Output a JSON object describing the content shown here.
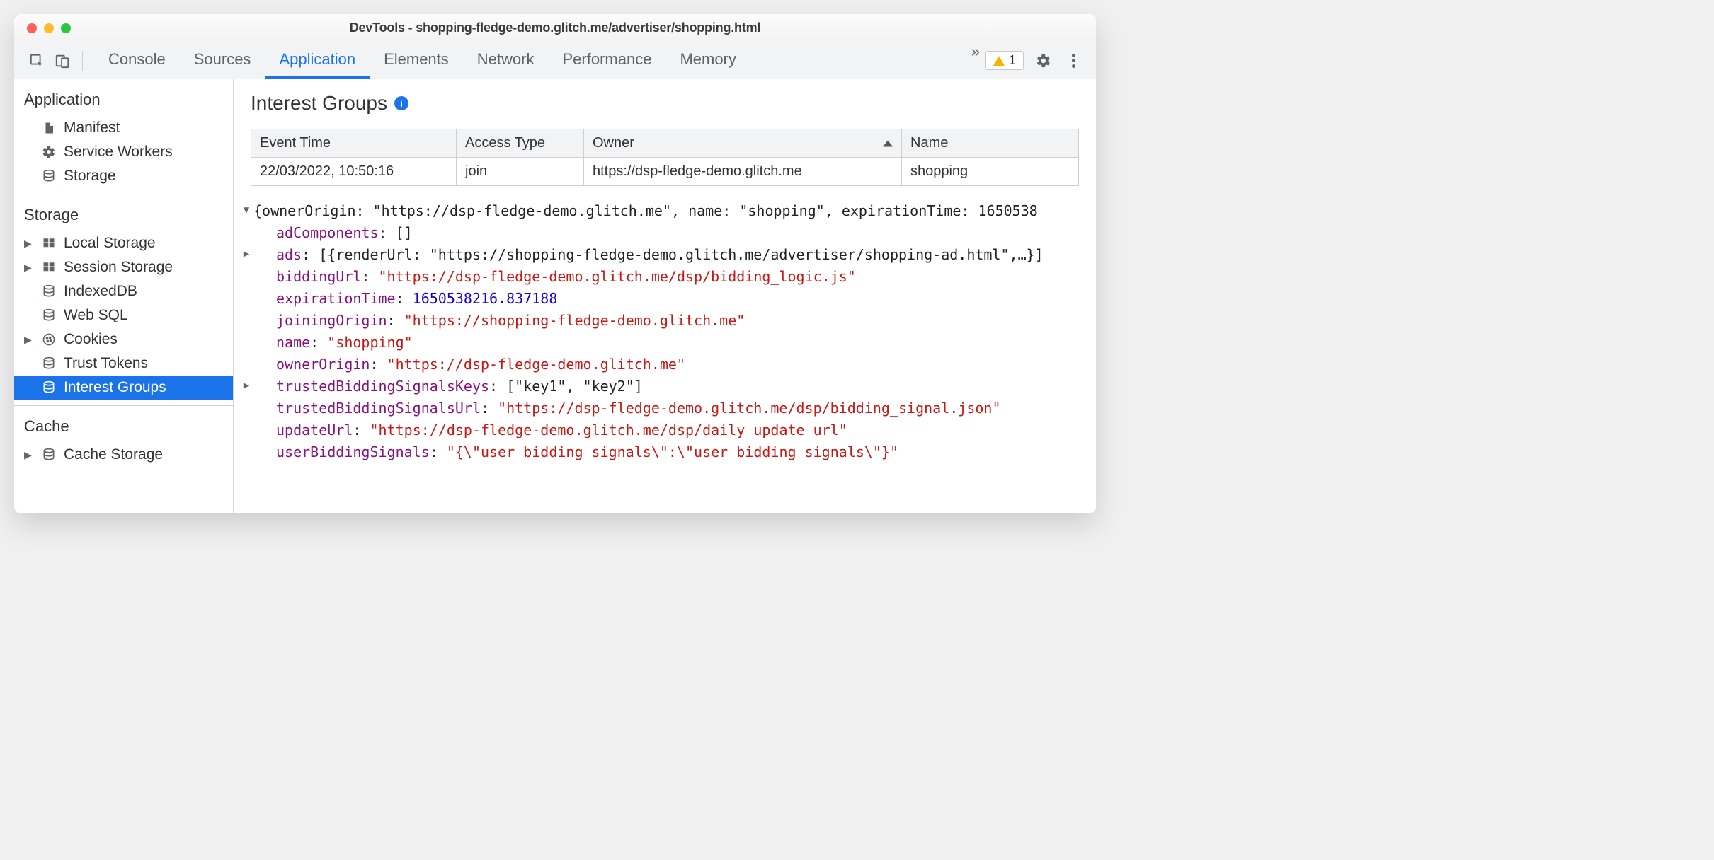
{
  "window": {
    "title": "DevTools - shopping-fledge-demo.glitch.me/advertiser/shopping.html"
  },
  "toolbar": {
    "tabs": [
      "Console",
      "Sources",
      "Application",
      "Elements",
      "Network",
      "Performance",
      "Memory"
    ],
    "active_tab_index": 2,
    "warnings_count": "1"
  },
  "sidebar": {
    "groups": [
      {
        "title": "Application",
        "items": [
          {
            "label": "Manifest",
            "icon": "file",
            "expandable": false
          },
          {
            "label": "Service Workers",
            "icon": "gear",
            "expandable": false
          },
          {
            "label": "Storage",
            "icon": "db",
            "expandable": false
          }
        ]
      },
      {
        "title": "Storage",
        "items": [
          {
            "label": "Local Storage",
            "icon": "grid",
            "expandable": true
          },
          {
            "label": "Session Storage",
            "icon": "grid",
            "expandable": true
          },
          {
            "label": "IndexedDB",
            "icon": "db",
            "expandable": false
          },
          {
            "label": "Web SQL",
            "icon": "db",
            "expandable": false
          },
          {
            "label": "Cookies",
            "icon": "cookie",
            "expandable": true
          },
          {
            "label": "Trust Tokens",
            "icon": "db",
            "expandable": false
          },
          {
            "label": "Interest Groups",
            "icon": "db",
            "expandable": false,
            "selected": true
          }
        ]
      },
      {
        "title": "Cache",
        "items": [
          {
            "label": "Cache Storage",
            "icon": "db",
            "expandable": true
          }
        ]
      }
    ]
  },
  "panel": {
    "title": "Interest Groups",
    "table": {
      "headers": [
        "Event Time",
        "Access Type",
        "Owner",
        "Name"
      ],
      "sort_column_index": 2,
      "rows": [
        [
          "22/03/2022, 10:50:16",
          "join",
          "https://dsp-fledge-demo.glitch.me",
          "shopping"
        ]
      ]
    },
    "object": {
      "summary_line": "{ownerOrigin: \"https://dsp-fledge-demo.glitch.me\", name: \"shopping\", expirationTime: 1650538",
      "props": {
        "adComponents": {
          "type": "plain",
          "value": "[]"
        },
        "ads": {
          "type": "plain",
          "value": "[{renderUrl: \"https://shopping-fledge-demo.glitch.me/advertiser/shopping-ad.html\",…}]",
          "expandable": true
        },
        "biddingUrl": {
          "type": "string",
          "value": "\"https://dsp-fledge-demo.glitch.me/dsp/bidding_logic.js\""
        },
        "expirationTime": {
          "type": "number",
          "value": "1650538216.837188"
        },
        "joiningOrigin": {
          "type": "string",
          "value": "\"https://shopping-fledge-demo.glitch.me\""
        },
        "name": {
          "type": "string",
          "value": "\"shopping\""
        },
        "ownerOrigin": {
          "type": "string",
          "value": "\"https://dsp-fledge-demo.glitch.me\""
        },
        "trustedBiddingSignalsKeys": {
          "type": "plain",
          "value": "[\"key1\", \"key2\"]",
          "expandable": true
        },
        "trustedBiddingSignalsUrl": {
          "type": "string",
          "value": "\"https://dsp-fledge-demo.glitch.me/dsp/bidding_signal.json\""
        },
        "updateUrl": {
          "type": "string",
          "value": "\"https://dsp-fledge-demo.glitch.me/dsp/daily_update_url\""
        },
        "userBiddingSignals": {
          "type": "string",
          "value": "\"{\\\"user_bidding_signals\\\":\\\"user_bidding_signals\\\"}\""
        }
      }
    }
  }
}
